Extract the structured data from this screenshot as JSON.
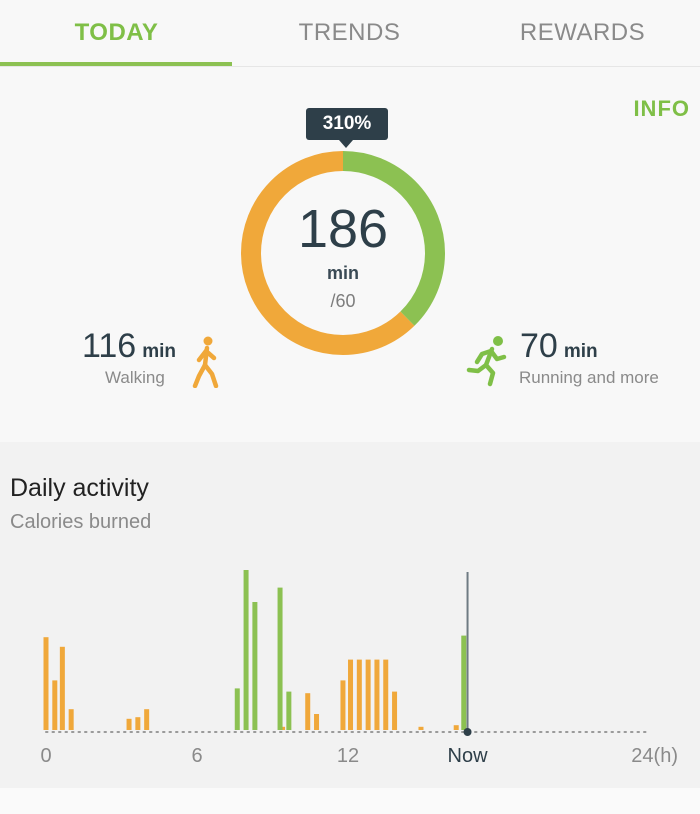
{
  "tabs": [
    {
      "label": "TODAY",
      "active": true
    },
    {
      "label": "TRENDS",
      "active": false
    },
    {
      "label": "REWARDS",
      "active": false
    }
  ],
  "info_label": "INFO",
  "summary": {
    "percent_badge": "310%",
    "total_value": "186",
    "total_unit": "min",
    "goal": "/60",
    "ring": {
      "walking_minutes": 116,
      "running_minutes": 70
    },
    "walking": {
      "value": "116",
      "unit": "min",
      "label": "Walking",
      "icon": "walking-person-icon"
    },
    "running": {
      "value": "70",
      "unit": "min",
      "label": "Running and more",
      "icon": "running-person-icon"
    }
  },
  "colors": {
    "accent_green": "#8cc152",
    "walking_orange": "#f0a83a",
    "running_green": "#8cc152",
    "dark": "#2e3f49"
  },
  "daily_activity": {
    "title": "Daily activity",
    "subtitle": "Calories burned"
  },
  "chart_data": {
    "type": "bar",
    "x_range": [
      0,
      24
    ],
    "x_ticks": [
      {
        "x": 0,
        "label": "0"
      },
      {
        "x": 6,
        "label": "6"
      },
      {
        "x": 12,
        "label": "12"
      },
      {
        "x": 16.75,
        "label": "Now"
      },
      {
        "x": 24,
        "label": "24(h)"
      }
    ],
    "now_hour": 16.75,
    "y_range": [
      0,
      100
    ],
    "series": [
      {
        "name": "Walking",
        "color": "#f0a83a",
        "points": [
          [
            0,
            58
          ],
          [
            0.35,
            31
          ],
          [
            0.65,
            52
          ],
          [
            1.0,
            13
          ],
          [
            3.3,
            7
          ],
          [
            3.65,
            8
          ],
          [
            4.0,
            13
          ],
          [
            9.4,
            2
          ],
          [
            10.4,
            23
          ],
          [
            10.75,
            10
          ],
          [
            11.8,
            31
          ],
          [
            12.1,
            44
          ],
          [
            12.45,
            44
          ],
          [
            12.8,
            44
          ],
          [
            13.15,
            44
          ],
          [
            13.5,
            44
          ],
          [
            13.85,
            24
          ],
          [
            14.9,
            2
          ],
          [
            16.3,
            3
          ]
        ]
      },
      {
        "name": "Running and more",
        "color": "#8cc152",
        "points": [
          [
            7.6,
            26
          ],
          [
            7.95,
            100
          ],
          [
            8.3,
            80
          ],
          [
            9.3,
            89
          ],
          [
            9.65,
            24
          ],
          [
            16.6,
            59
          ]
        ]
      }
    ]
  }
}
